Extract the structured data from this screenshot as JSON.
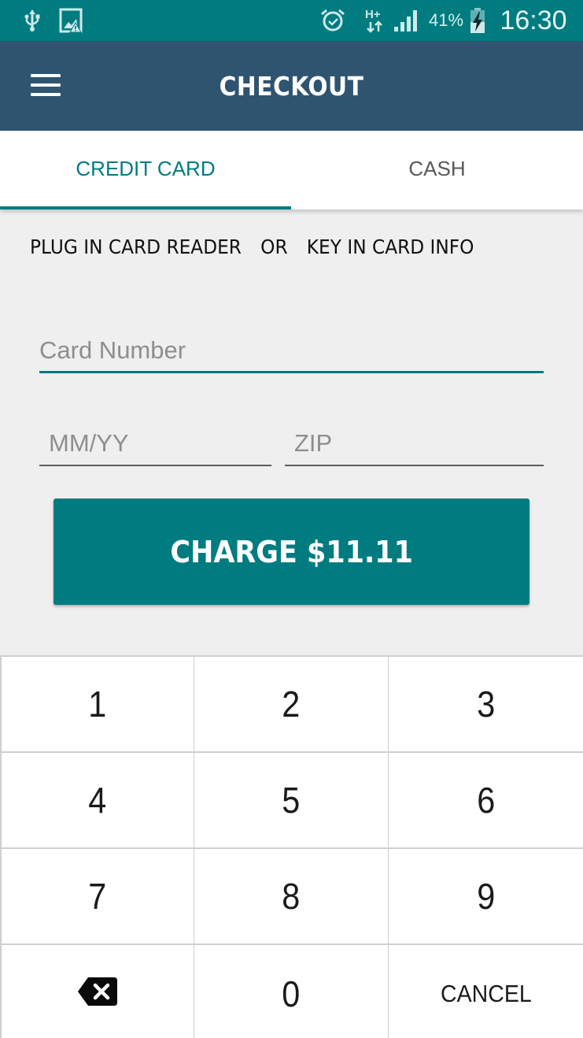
{
  "status_bar": {
    "left_icons": [
      "usb-icon",
      "image-warning-icon"
    ],
    "right_icons": [
      "alarm-icon",
      "hplus-data-icon",
      "signal-icon",
      "battery-charging-icon"
    ],
    "battery_percent": "41%",
    "network_type": "H+",
    "time": "16:30"
  },
  "header": {
    "menu_icon": "hamburger-menu-icon",
    "title": "CHECKOUT"
  },
  "tabs": [
    {
      "label": "CREDIT CARD",
      "active": true
    },
    {
      "label": "CASH",
      "active": false
    }
  ],
  "instruction": {
    "left": "PLUG IN CARD READER",
    "middle": "OR",
    "right": "KEY IN CARD INFO"
  },
  "form": {
    "card_number": {
      "value": "",
      "placeholder": "Card Number"
    },
    "expiry": {
      "value": "",
      "placeholder": "MM/YY"
    },
    "zip": {
      "value": "",
      "placeholder": "ZIP"
    }
  },
  "charge_button": {
    "label": "CHARGE $11.11",
    "amount": "$11.11"
  },
  "keypad": {
    "keys": [
      "1",
      "2",
      "3",
      "4",
      "5",
      "6",
      "7",
      "8",
      "9",
      "backspace-icon",
      "0",
      "CANCEL"
    ],
    "cancel_label": "CANCEL"
  },
  "colors": {
    "status_bar": "#007c80",
    "header": "#2f5470",
    "accent": "#007c80",
    "background": "#efefef"
  }
}
